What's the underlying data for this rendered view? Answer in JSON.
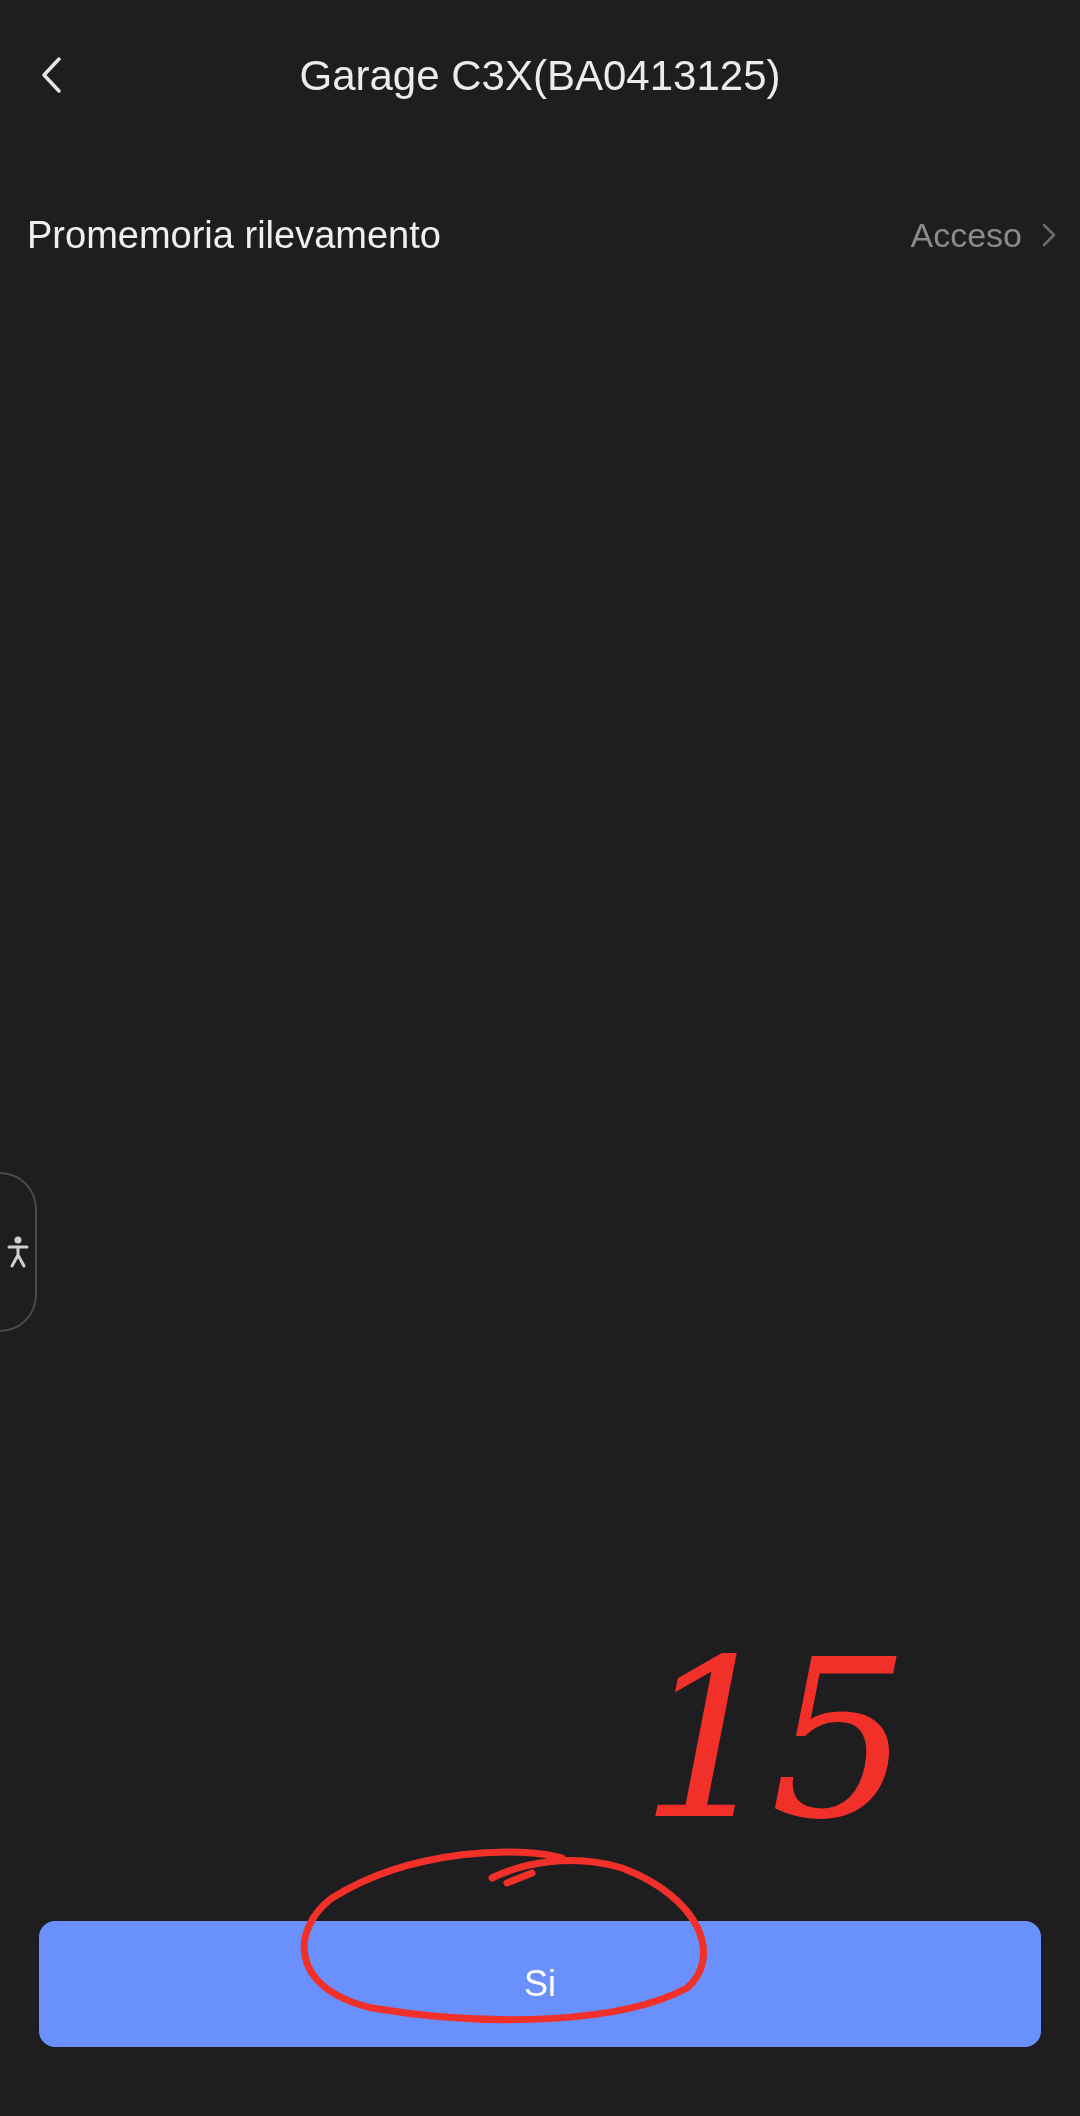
{
  "header": {
    "title": "Garage C3X(BA0413125)"
  },
  "settings": [
    {
      "label": "Promemoria rilevamento",
      "value": "Acceso"
    }
  ],
  "primary_button": {
    "label": "Si"
  },
  "annotation": {
    "text": "15"
  }
}
